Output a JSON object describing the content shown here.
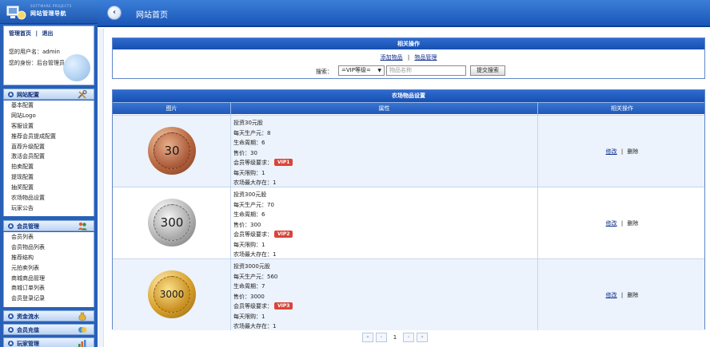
{
  "sidebar": {
    "logo": {
      "subtitle": "SOFTWARE PROJECTS",
      "title": "网站管理导航"
    },
    "user_panel": {
      "link_home": "管理首页",
      "separator": "|",
      "link_logout": "退出",
      "username_line": "您的用户名：admin",
      "role_line": "您的身份：后台管理员"
    },
    "sections": [
      {
        "title": "网站配置",
        "icon": "tools-icon",
        "items": [
          "基本配置",
          "网站Logo",
          "客服设置",
          "推荐会员提成配置",
          "直荐升级配置",
          "激活会员配置",
          "拍卖配置",
          "提现配置",
          "抽奖配置",
          "农场物品设置",
          "玩家公告"
        ]
      },
      {
        "title": "会员管理",
        "icon": "users-icon",
        "items": [
          "会员列表",
          "会员物品列表",
          "推荐结构",
          "元拍卖列表",
          "商城商品管理",
          "商城订单列表",
          "会员登录记录"
        ]
      },
      {
        "title": "资金流水",
        "icon": "money-bag-icon",
        "items": []
      },
      {
        "title": "会员充值",
        "icon": "recharge-icon",
        "items": []
      },
      {
        "title": "玩家管理",
        "icon": "chart-icon",
        "items": []
      }
    ]
  },
  "topbar": {
    "title": "网站首页",
    "back_icon": "back-arrow-icon"
  },
  "ops_panel": {
    "header": "相关操作",
    "link_add": "添加物品",
    "separator": "|",
    "link_manage": "物品管理",
    "search_label": "搜索：",
    "vip_select_value": "=VIP等级=",
    "item_input_placeholder": "物品名称",
    "search_button": "提交搜索"
  },
  "farm_panel": {
    "header": "农场物品设置",
    "columns": [
      "图片",
      "属性",
      "相关操作"
    ],
    "rows": [
      {
        "coin_label": "30",
        "coin_color": "#b8673f",
        "attrs": [
          "投资30元股",
          "每天生产元：8",
          "生命周期：6",
          "售价：30"
        ],
        "vip_label": "会员等级要求：",
        "vip_badge": "VIP1",
        "tail_attrs": [
          "每天限购：1",
          "农场最大存在：1"
        ],
        "edit": "修改",
        "separator": "|",
        "delete": "删除"
      },
      {
        "coin_label": "300",
        "coin_color": "#b5b5b5",
        "attrs": [
          "投资300元股",
          "每天生产元：70",
          "生命周期：6",
          "售价：300"
        ],
        "vip_label": "会员等级要求：",
        "vip_badge": "VIP2",
        "tail_attrs": [
          "每天限购：1",
          "农场最大存在：1"
        ],
        "edit": "修改",
        "separator": "|",
        "delete": "删除"
      },
      {
        "coin_label": "3000",
        "coin_color": "#d9a12c",
        "attrs": [
          "投资3000元股",
          "每天生产元：560",
          "生命周期：7",
          "售价：3000"
        ],
        "vip_label": "会员等级要求：",
        "vip_badge": "VIP3",
        "tail_attrs": [
          "每天限购：1",
          "农场最大存在：1"
        ],
        "edit": "修改",
        "separator": "|",
        "delete": "删除"
      }
    ]
  },
  "pagination": {
    "current_page": "1",
    "first": "«",
    "prev": "‹",
    "next": "›",
    "last": "»"
  },
  "colors": {
    "primary_blue": "#1a57b8",
    "vip_badge": "#d9453b",
    "link": "#0b2c8a"
  }
}
